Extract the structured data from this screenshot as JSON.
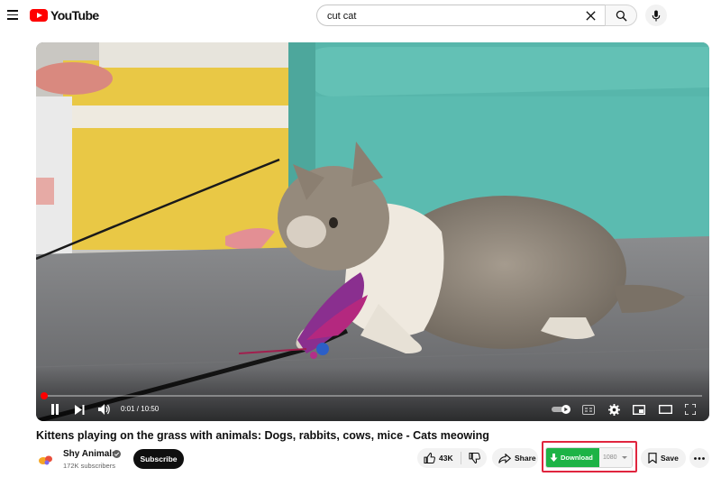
{
  "app": {
    "logo_text": "YouTube"
  },
  "search": {
    "query": "cut cat",
    "placeholder": "Search"
  },
  "player": {
    "current_time": "0:01",
    "duration": "10:50",
    "time_display": "0:01 / 10:50",
    "progress_fraction": 0.0015,
    "state": "playing",
    "autoplay_on": true
  },
  "video": {
    "title": "Kittens playing on the grass with animals: Dogs, rabbits, cows, mice - Cats meowing"
  },
  "channel": {
    "name": "Shy Animals",
    "verified": true,
    "subscribers": "172K subscribers",
    "subscribe_label": "Subscribe"
  },
  "actions": {
    "likes": "43K",
    "share_label": "Share",
    "download_label": "Download",
    "download_quality": "1080",
    "save_label": "Save"
  },
  "colors": {
    "brand_red": "#ff0000",
    "download_green": "#1db346",
    "highlight_border": "#e0253e",
    "subscribe_bg": "#0f0f0f"
  },
  "icons": [
    "menu-icon",
    "youtube-logo-icon",
    "clear-icon",
    "search-icon",
    "mic-icon",
    "pause-icon",
    "next-icon",
    "volume-icon",
    "autoplay-toggle-icon",
    "captions-icon",
    "settings-icon",
    "miniplayer-icon",
    "theater-icon",
    "fullscreen-icon",
    "verified-icon",
    "like-icon",
    "dislike-icon",
    "share-icon",
    "download-icon",
    "save-icon",
    "more-icon"
  ]
}
